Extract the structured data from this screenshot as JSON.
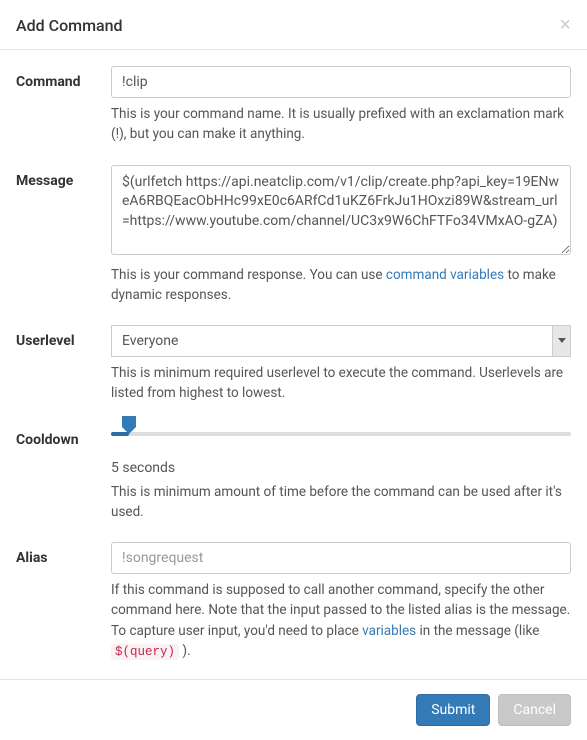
{
  "header": {
    "title": "Add Command"
  },
  "command": {
    "label": "Command",
    "value": "!clip",
    "help": "This is your command name. It is usually prefixed with an exclamation mark (!), but you can make it anything."
  },
  "message": {
    "label": "Message",
    "value": "$(urlfetch https://api.neatclip.com/v1/clip/create.php?api_key=19ENweA6RBQEacObHHc99xE0c6ARfCd1uKZ6FrkJu1HOxzi89W&stream_url=https://www.youtube.com/channel/UC3x9W6ChFTFo34VMxAO-gZA)",
    "help_before": "This is your command response. You can use ",
    "help_link": "command variables",
    "help_after": " to make dynamic responses."
  },
  "userlevel": {
    "label": "Userlevel",
    "selected": "Everyone",
    "help": "This is minimum required userlevel to execute the command. Userlevels are listed from highest to lowest."
  },
  "cooldown": {
    "label": "Cooldown",
    "value_text": "5 seconds",
    "percent": 4,
    "help": "This is minimum amount of time before the command can be used after it's used."
  },
  "alias": {
    "label": "Alias",
    "placeholder": "!songrequest",
    "help_1": "If this command is supposed to call another command, specify the other command here. Note that the input passed to the listed alias is the message. To capture user input, you'd need to place ",
    "help_link": "variables",
    "help_2": " in the message (like ",
    "help_code": "$(query)",
    "help_3": " )."
  },
  "footer": {
    "submit": "Submit",
    "cancel": "Cancel"
  }
}
